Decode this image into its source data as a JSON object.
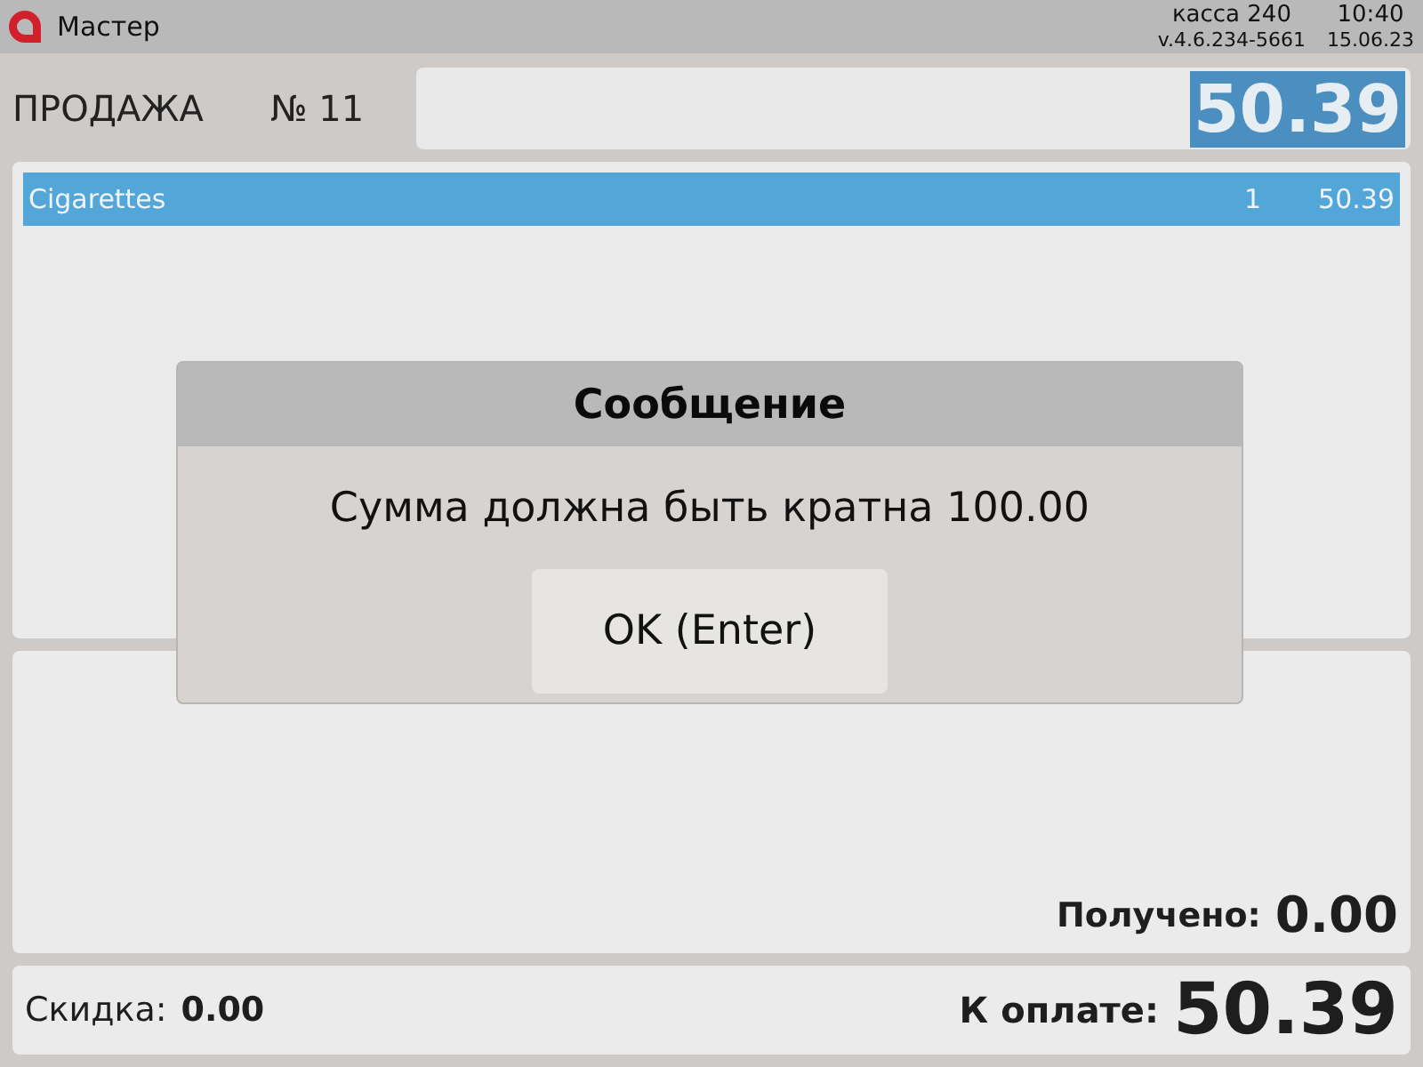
{
  "title_bar": {
    "app_name": "Мастер",
    "register": "касса 240",
    "time": "10:40",
    "version": "v.4.6.234-5661",
    "date": "15.06.23"
  },
  "header": {
    "operation": "ПРОДАЖА",
    "receipt_number": "№ 11",
    "amount_field": {
      "value": "50.39",
      "value_selected": true
    }
  },
  "items": [
    {
      "name": "Cigarettes",
      "quantity": "1",
      "sum": "50.39",
      "selected": true
    }
  ],
  "payment": {
    "received_label": "Получено:",
    "received_value": "0.00"
  },
  "totals": {
    "discount_label": "Скидка:",
    "discount_value": "0.00",
    "due_label": "К оплате:",
    "due_value": "50.39"
  },
  "dialog": {
    "title": "Сообщение",
    "message": "Сумма должна быть кратна 100.00",
    "buttons": [
      "OK (Enter)"
    ]
  }
}
